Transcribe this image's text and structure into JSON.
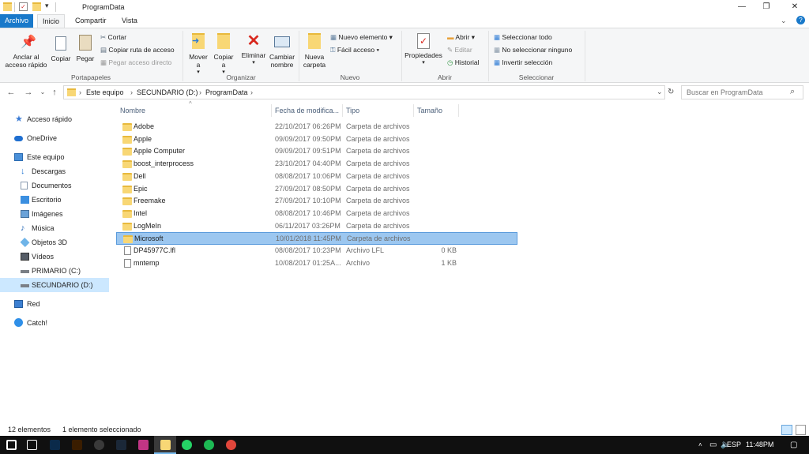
{
  "window": {
    "title": "ProgramData",
    "min_glyph": "—",
    "max_glyph": "❐",
    "close_glyph": "✕"
  },
  "ribbon_tabs": [
    "Archivo",
    "Inicio",
    "Compartir",
    "Vista"
  ],
  "ribbon": {
    "portapapeles": {
      "label": "Portapapeles",
      "pin": "Anclar al acceso rápido",
      "copy": "Copiar",
      "paste": "Pegar",
      "cut": "Cortar",
      "copy_path": "Copiar ruta de acceso",
      "paste_shortcut": "Pegar acceso directo"
    },
    "organizar": {
      "label": "Organizar",
      "move": "Mover a",
      "copy_to": "Copiar a",
      "delete": "Eliminar",
      "rename": "Cambiar nombre"
    },
    "nuevo": {
      "label": "Nuevo",
      "new_folder": "Nueva carpeta",
      "new_item": "Nuevo elemento",
      "easy_access": "Fácil acceso"
    },
    "abrir": {
      "label": "Abrir",
      "properties": "Propiedades",
      "open": "Abrir",
      "edit": "Editar",
      "history": "Historial"
    },
    "seleccionar": {
      "label": "Seleccionar",
      "select_all": "Seleccionar todo",
      "select_none": "No seleccionar ninguno",
      "invert": "Invertir selección"
    }
  },
  "address": {
    "crumbs": [
      "Este equipo",
      "SECUNDARIO (D:)",
      "ProgramData"
    ],
    "search_placeholder": "Buscar en ProgramData"
  },
  "nav": [
    {
      "label": "Acceso rápido",
      "icon": "star-icon",
      "color": "#3a7bd5"
    },
    {
      "label": "OneDrive",
      "icon": "cloud-icon",
      "color": "#1f6fd0"
    },
    {
      "label": "Este equipo",
      "icon": "computer-icon",
      "color": "#4a90d9"
    },
    {
      "label": "Descargas",
      "icon": "download-icon",
      "color": "#2a7ad5"
    },
    {
      "label": "Documentos",
      "icon": "documents-icon",
      "color": "#8a9bb0"
    },
    {
      "label": "Escritorio",
      "icon": "desktop-icon",
      "color": "#3b8fe0"
    },
    {
      "label": "Imágenes",
      "icon": "pictures-icon",
      "color": "#6aa2d8"
    },
    {
      "label": "Música",
      "icon": "music-icon",
      "color": "#2b6cb8"
    },
    {
      "label": "Objetos 3D",
      "icon": "objects-3d-icon",
      "color": "#6fb4e8"
    },
    {
      "label": "Vídeos",
      "icon": "videos-icon",
      "color": "#555c66"
    },
    {
      "label": "PRIMARIO (C:)",
      "icon": "drive-icon",
      "color": "#7a7f86"
    },
    {
      "label": "SECUNDARIO (D:)",
      "icon": "drive-icon",
      "color": "#7a7f86"
    },
    {
      "label": "Red",
      "icon": "network-icon",
      "color": "#3c7fd1"
    },
    {
      "label": "Catch!",
      "icon": "catch-icon",
      "color": "#2f8fe8"
    }
  ],
  "columns": [
    "Nombre",
    "Fecha de modifica...",
    "Tipo",
    "Tamaño"
  ],
  "files": [
    {
      "name": "Adobe",
      "date": "22/10/2017 06:26PM",
      "type": "Carpeta de archivos",
      "size": "",
      "kind": "folder"
    },
    {
      "name": "Apple",
      "date": "09/09/2017 09:50PM",
      "type": "Carpeta de archivos",
      "size": "",
      "kind": "folder"
    },
    {
      "name": "Apple Computer",
      "date": "09/09/2017 09:51PM",
      "type": "Carpeta de archivos",
      "size": "",
      "kind": "folder"
    },
    {
      "name": "boost_interprocess",
      "date": "23/10/2017 04:40PM",
      "type": "Carpeta de archivos",
      "size": "",
      "kind": "folder"
    },
    {
      "name": "Dell",
      "date": "08/08/2017 10:06PM",
      "type": "Carpeta de archivos",
      "size": "",
      "kind": "folder"
    },
    {
      "name": "Epic",
      "date": "27/09/2017 08:50PM",
      "type": "Carpeta de archivos",
      "size": "",
      "kind": "folder"
    },
    {
      "name": "Freemake",
      "date": "27/09/2017 10:10PM",
      "type": "Carpeta de archivos",
      "size": "",
      "kind": "folder"
    },
    {
      "name": "Intel",
      "date": "08/08/2017 10:46PM",
      "type": "Carpeta de archivos",
      "size": "",
      "kind": "folder"
    },
    {
      "name": "LogMeIn",
      "date": "06/11/2017 03:26PM",
      "type": "Carpeta de archivos",
      "size": "",
      "kind": "folder"
    },
    {
      "name": "Microsoft",
      "date": "10/01/2018 11:45PM",
      "type": "Carpeta de archivos",
      "size": "",
      "kind": "folder",
      "selected": true
    },
    {
      "name": "DP45977C.lfl",
      "date": "08/08/2017 10:23PM",
      "type": "Archivo LFL",
      "size": "0 KB",
      "kind": "file"
    },
    {
      "name": "mntemp",
      "date": "10/08/2017 01:25A...",
      "type": "Archivo",
      "size": "1 KB",
      "kind": "file"
    }
  ],
  "status": {
    "count": "12 elementos",
    "selected": "1 elemento seleccionado"
  },
  "taskbar": {
    "apps": [
      {
        "name": "windows-start-icon",
        "color": "#ffffff"
      },
      {
        "name": "task-view-icon",
        "color": "#ffffff"
      },
      {
        "name": "photoshop-icon",
        "color": "#0b2a4a"
      },
      {
        "name": "illustrator-icon",
        "color": "#3a1d00"
      },
      {
        "name": "obs-icon",
        "color": "#3a3a3a"
      },
      {
        "name": "steam-icon",
        "color": "#1b2838"
      },
      {
        "name": "instagram-icon",
        "color": "#c13584"
      },
      {
        "name": "file-explorer-icon",
        "color": "#f8d775"
      },
      {
        "name": "whatsapp-icon",
        "color": "#25d366"
      },
      {
        "name": "spotify-icon",
        "color": "#1db954"
      },
      {
        "name": "chrome-icon",
        "color": "#e0463b"
      }
    ],
    "lang": "ESP",
    "time": "11:48PM"
  }
}
